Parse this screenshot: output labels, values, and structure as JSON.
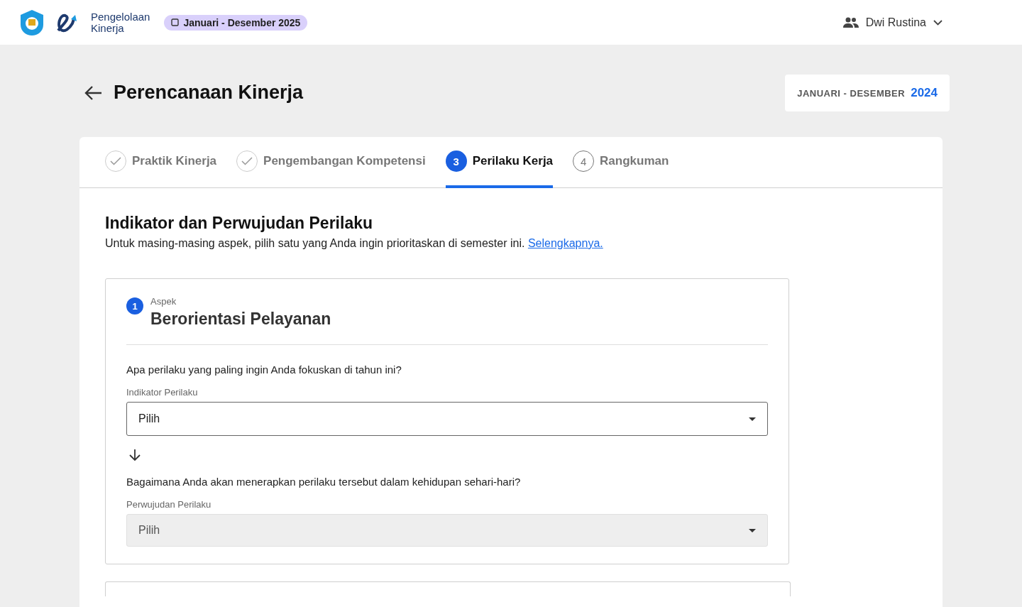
{
  "header": {
    "logo_text": [
      "Pengelolaan",
      "Kinerja"
    ],
    "period_badge": "Januari - Desember 2025",
    "user": "Dwi Rustina"
  },
  "page": {
    "title": "Perencanaan Kinerja",
    "period_label": "JANUARI - DESEMBER",
    "period_year": "2024"
  },
  "steps": [
    {
      "label": "Praktik Kinerja",
      "completed": true,
      "selected": false
    },
    {
      "label": "Pengembangan Kompetensi",
      "completed": true,
      "selected": false
    },
    {
      "label": "Perilaku Kerja",
      "marker": "3",
      "completed": false,
      "selected": true
    },
    {
      "label": "Rangkuman",
      "marker": "4",
      "completed": false,
      "selected": false
    }
  ],
  "section": {
    "title": "Indikator dan Perwujudan Perilaku",
    "description": "Untuk masing-masing aspek, pilih satu yang Anda ingin prioritaskan di semester ini.",
    "link": "Selengkapnya."
  },
  "aspects": [
    {
      "number": "1",
      "caption": "Aspek",
      "name": "Berorientasi Pelayanan",
      "questions": [
        {
          "question": "Apa perilaku yang paling ingin Anda fokuskan di tahun ini?",
          "label": "Indikator Perilaku",
          "placeholder": "Pilih",
          "disabled": false
        },
        {
          "question": "Bagaimana Anda akan menerapkan perilaku tersebut dalam kehidupan sehari-hari?",
          "label": "Perwujudan Perilaku",
          "placeholder": "Pilih",
          "disabled": true
        }
      ]
    }
  ]
}
